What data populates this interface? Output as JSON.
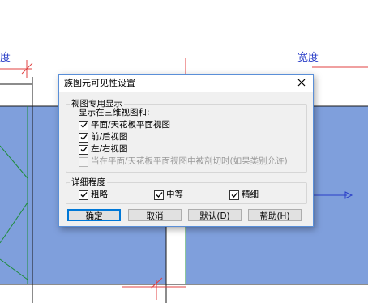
{
  "background": {
    "label_left": "度",
    "label_right": "宽度"
  },
  "dialog": {
    "title": "族图元可见性设置",
    "close_glyph": "✕",
    "view_group": {
      "label": "视图专用显示",
      "subtitle": "显示在三维视图和:",
      "options": [
        {
          "label": "平面/天花板平面视图",
          "checked": true,
          "enabled": true
        },
        {
          "label": "前/后视图",
          "checked": true,
          "enabled": true
        },
        {
          "label": "左/右视图",
          "checked": true,
          "enabled": true
        },
        {
          "label": "当在平面/天花板平面视图中被剖切时(如果类别允许)",
          "checked": false,
          "enabled": false
        }
      ]
    },
    "detail_group": {
      "label": "详细程度",
      "options": [
        {
          "label": "粗略",
          "checked": true
        },
        {
          "label": "中等",
          "checked": true
        },
        {
          "label": "精细",
          "checked": true
        }
      ]
    },
    "buttons": {
      "ok": "确定",
      "cancel": "取消",
      "default": "默认(D)",
      "help": "帮助(H)"
    }
  }
}
